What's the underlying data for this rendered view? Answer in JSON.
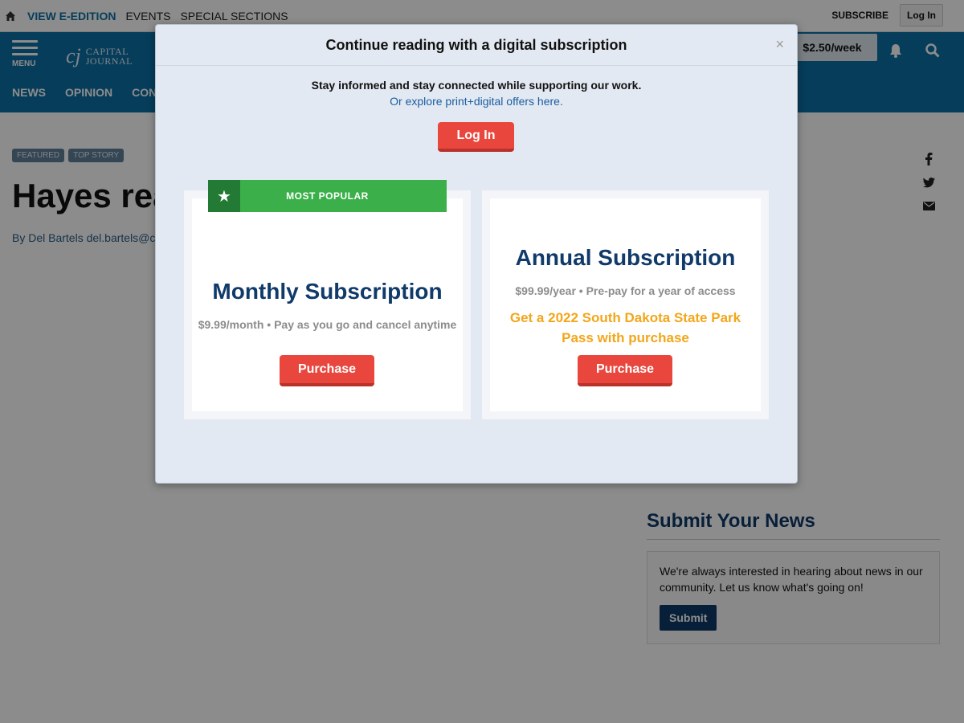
{
  "topbar": {
    "links": [
      "VIEW E-EDITION",
      "EVENTS",
      "SPECIAL SECTIONS"
    ],
    "subscribe": "SUBSCRIBE",
    "login": "Log In"
  },
  "masthead": {
    "menu_label": "MENU",
    "logo_mark": "cj",
    "logo_line1": "CAPITAL",
    "logo_line2": "JOURNAL",
    "price_button": "$2.50/week",
    "nav": [
      "NEWS",
      "OPINION",
      "CON"
    ]
  },
  "article": {
    "badges": [
      "FEATURED",
      "TOP STORY"
    ],
    "headline": "Hayes rea",
    "byline": "By Del Bartels del.bartels@ca"
  },
  "sidebar": {
    "submit_title": "Submit Your News",
    "submit_text": "We're always interested in hearing about news in our community. Let us know what's going on!",
    "submit_button": "Submit"
  },
  "modal": {
    "title": "Continue reading with a digital subscription",
    "close": "×",
    "lead": "Stay informed and stay connected while supporting our work.",
    "explore": "Or explore print+digital offers here.",
    "login": "Log In",
    "popular_label": "MOST POPULAR",
    "plans": [
      {
        "title": "Monthly Subscription",
        "price": "$9.99/month • Pay as you go and cancel anytime",
        "button": "Purchase"
      },
      {
        "title": "Annual Subscription",
        "price": "$99.99/year • Pre-pay for a year of access",
        "promo": "Get a 2022 South Dakota State Park Pass with purchase",
        "button": "Purchase"
      }
    ]
  },
  "colors": {
    "masthead": "#0b6fa6",
    "accent_red": "#e9473e",
    "popular_green": "#3bb04a",
    "title_blue": "#0f3a69",
    "promo_orange": "#f3a619"
  }
}
